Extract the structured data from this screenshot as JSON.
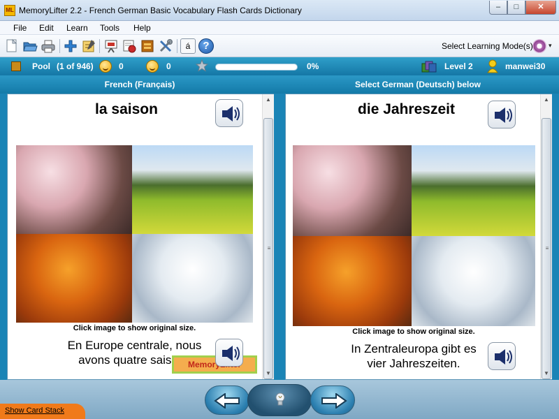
{
  "window": {
    "icon_text": "ML",
    "title": "MemoryLifter 2.2 - French German Basic Vocabulary Flash Cards Dictionary",
    "minimize": "–",
    "maximize": "□",
    "close": "✕"
  },
  "menu": [
    "File",
    "Edit",
    "Learn",
    "Tools",
    "Help"
  ],
  "toolbar": {
    "icons": [
      "new-file-icon",
      "open-folder-icon",
      "print-icon",
      "add-card-icon",
      "edit-card-icon",
      "presentation-icon",
      "settings-card-icon",
      "book-icon",
      "tools-icon",
      "special-char-icon",
      "help-icon"
    ],
    "special_char": "á",
    "help": "?",
    "mode_label": "Select Learning Mode(s)",
    "mode_arrow": "▾"
  },
  "status": {
    "box": "Pool",
    "count": "(1 of 946)",
    "correct": "0",
    "wrong": "0",
    "progress_percent": 0,
    "progress_text": "0%",
    "level": "Level 2",
    "user": "manwei30"
  },
  "headers": {
    "left": "French (Français)",
    "right": "Select German (Deutsch) below"
  },
  "question": {
    "word": "la saison",
    "caption": "Click image to show original size.",
    "sentence_line1": "En Europe centrale, nous",
    "sentence_line2": "avons quatre saisons"
  },
  "answer": {
    "word": "die Jahreszeit",
    "caption": "Click image to show original size.",
    "sentence_line1": "In Zentraleuropa gibt es",
    "sentence_line2": "vier Jahreszeiten."
  },
  "logo_text": "MemoryLifter",
  "scrollbar": {
    "up": "▲",
    "down": "▼",
    "grip": "≡"
  },
  "bottom": {
    "show_card_stack": "Show Card Stack"
  },
  "colors": {
    "accent": "#1a84b6",
    "title_bar": "#c3d6ec",
    "stack_tab": "#f07a1a"
  }
}
